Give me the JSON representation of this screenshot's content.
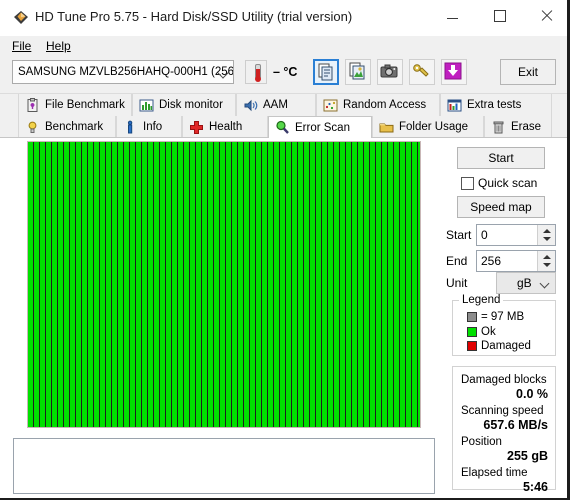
{
  "window": {
    "title": "HD Tune Pro 5.75 - Hard Disk/SSD Utility (trial version)",
    "app_icon": "hdtune-diamond-icon",
    "minimize_label": "–",
    "maximize_label": "□",
    "close_label": "✕"
  },
  "menu": {
    "items": [
      {
        "label": "File",
        "accel": "F"
      },
      {
        "label": "Help",
        "accel": "H"
      }
    ]
  },
  "toolbar": {
    "drive": "SAMSUNG MZVLB256HAHQ-000H1 (256",
    "temperature": "– °C",
    "buttons": [
      {
        "name": "copy-icon",
        "selected": true
      },
      {
        "name": "copy-image-icon",
        "selected": false
      },
      {
        "name": "camera-icon",
        "selected": false
      },
      {
        "name": "folder-key-icon",
        "selected": false
      },
      {
        "name": "download-arrow-icon",
        "selected": false
      }
    ],
    "exit_label": "Exit"
  },
  "tabs": {
    "row1": [
      {
        "label": "File Benchmark",
        "icon": "clipboard-icon",
        "active": false
      },
      {
        "label": "Disk monitor",
        "icon": "bar-chart-icon",
        "active": false
      },
      {
        "label": "AAM",
        "icon": "speaker-icon",
        "active": false
      },
      {
        "label": "Random Access",
        "icon": "scatter-icon",
        "active": false
      },
      {
        "label": "Extra tests",
        "icon": "chart-grid-icon",
        "active": false
      }
    ],
    "row2": [
      {
        "label": "Benchmark",
        "icon": "bulb-icon",
        "active": false
      },
      {
        "label": "Info",
        "icon": "info-icon",
        "active": false
      },
      {
        "label": "Health",
        "icon": "red-cross-icon",
        "active": false
      },
      {
        "label": "Error Scan",
        "icon": "magnifier-icon",
        "active": true
      },
      {
        "label": "Folder Usage",
        "icon": "folder-icon",
        "active": false
      },
      {
        "label": "Erase",
        "icon": "trash-icon",
        "active": false
      }
    ]
  },
  "scan_map": {
    "block_color_ok": "#00e000",
    "block_color_damaged": "#e00000",
    "background_color": "#1f1f1f",
    "columns": 66,
    "rows": 48,
    "log_text": ""
  },
  "controls": {
    "start_label": "Start",
    "quick_scan_label": "Quick scan",
    "quick_scan_checked": false,
    "speed_map_label": "Speed map",
    "start_field_label": "Start",
    "start_field_value": "0",
    "end_field_label": "End",
    "end_field_value": "256",
    "unit_label": "Unit",
    "unit_value": "gB"
  },
  "legend": {
    "title": "Legend",
    "items": [
      {
        "swatch": "gray",
        "label": "= 97 MB"
      },
      {
        "swatch": "green",
        "label": "Ok"
      },
      {
        "swatch": "red",
        "label": "Damaged"
      }
    ]
  },
  "stats": {
    "damaged_blocks_label": "Damaged blocks",
    "damaged_blocks_value": "0.0 %",
    "scanning_speed_label": "Scanning speed",
    "scanning_speed_value": "657.6 MB/s",
    "position_label": "Position",
    "position_value": "255 gB",
    "elapsed_time_label": "Elapsed time",
    "elapsed_time_value": "5:46"
  }
}
